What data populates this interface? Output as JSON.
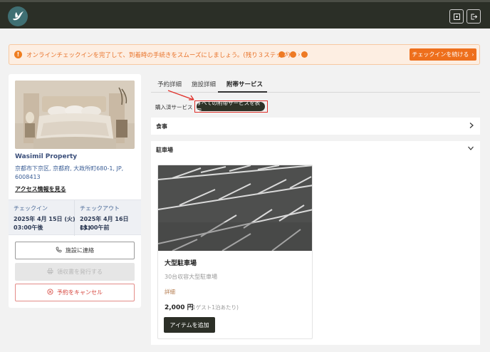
{
  "header": {
    "logo_icon": "bird-logo-icon",
    "actions": [
      "receipt-icon",
      "logout-icon"
    ]
  },
  "banner": {
    "message": "オンラインチェックインを完了して、到着時の手続きをスムーズにしましょう。(残り３ステップ)",
    "cta_label": "チェックインを続ける",
    "steps_remaining": 3,
    "accent": "#ee6f1c"
  },
  "property": {
    "name": "Wasimil Property",
    "address": "京都市下京区, 京都府, 大政所町680-1, JP, 6008413",
    "access_link": "アクセス情報を見る",
    "checkin_label": "チェックイン",
    "checkin_date": "2025年 4月 15日 (火)",
    "checkin_time": "03:00午後",
    "checkout_label": "チェックアウト",
    "checkout_date": "2025年 4月 16日 (水)",
    "checkout_time": "11:00午前",
    "contact_label": "施設に連絡",
    "receipt_label": "領収書を発行する",
    "cancel_label": "予約をキャンセル"
  },
  "tabs": [
    {
      "label": "予約詳細",
      "active": false
    },
    {
      "label": "施設詳細",
      "active": false
    },
    {
      "label": "附帯サービス",
      "active": true
    }
  ],
  "filters": {
    "purchased_label": "購入済サービス",
    "show_all_label": "すべての附帯サービスを表示"
  },
  "sections": [
    {
      "label": "食事",
      "expanded": false
    },
    {
      "label": "駐車場",
      "expanded": true
    }
  ],
  "parking_item": {
    "title": "大型駐車場",
    "description": "30台収容大型駐車場",
    "detail_link": "詳細",
    "price": "2,000 円",
    "price_note": "(1ゲスト1泊あたり)",
    "add_label": "アイテムを追加"
  }
}
